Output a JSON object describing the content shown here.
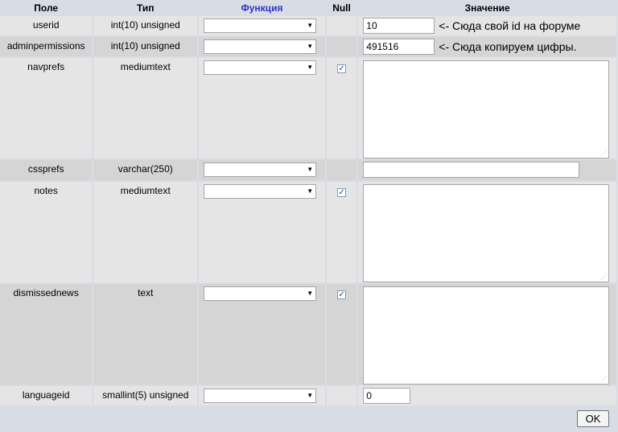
{
  "headers": {
    "field": "Поле",
    "type": "Тип",
    "function": "Функция",
    "null": "Null",
    "value": "Значение"
  },
  "rows": [
    {
      "field": "userid",
      "type": "int(10) unsigned",
      "value": "10",
      "note": "<- Сюда свой id на форуме",
      "null_checked": false
    },
    {
      "field": "adminpermissions",
      "type": "int(10) unsigned",
      "value": "491516",
      "note": "<- Сюда копируем цифры.",
      "null_checked": false
    },
    {
      "field": "navprefs",
      "type": "mediumtext",
      "value": "",
      "null_checked": true
    },
    {
      "field": "cssprefs",
      "type": "varchar(250)",
      "value": "",
      "null_checked": false
    },
    {
      "field": "notes",
      "type": "mediumtext",
      "value": "",
      "null_checked": true
    },
    {
      "field": "dismissednews",
      "type": "text",
      "value": "",
      "null_checked": true
    },
    {
      "field": "languageid",
      "type": "smallint(5) unsigned",
      "value": "0",
      "null_checked": false
    }
  ],
  "footer": {
    "ok_label": "OK"
  },
  "glyphs": {
    "dropdown_arrow": "▼",
    "checkmark": "✓",
    "resize_grip": "⋰"
  },
  "colors": {
    "header_bg": "#d8dde5",
    "row_light": "#e5e5e5",
    "row_dark": "#d5d5d5",
    "function_header": "#2a32c8"
  }
}
